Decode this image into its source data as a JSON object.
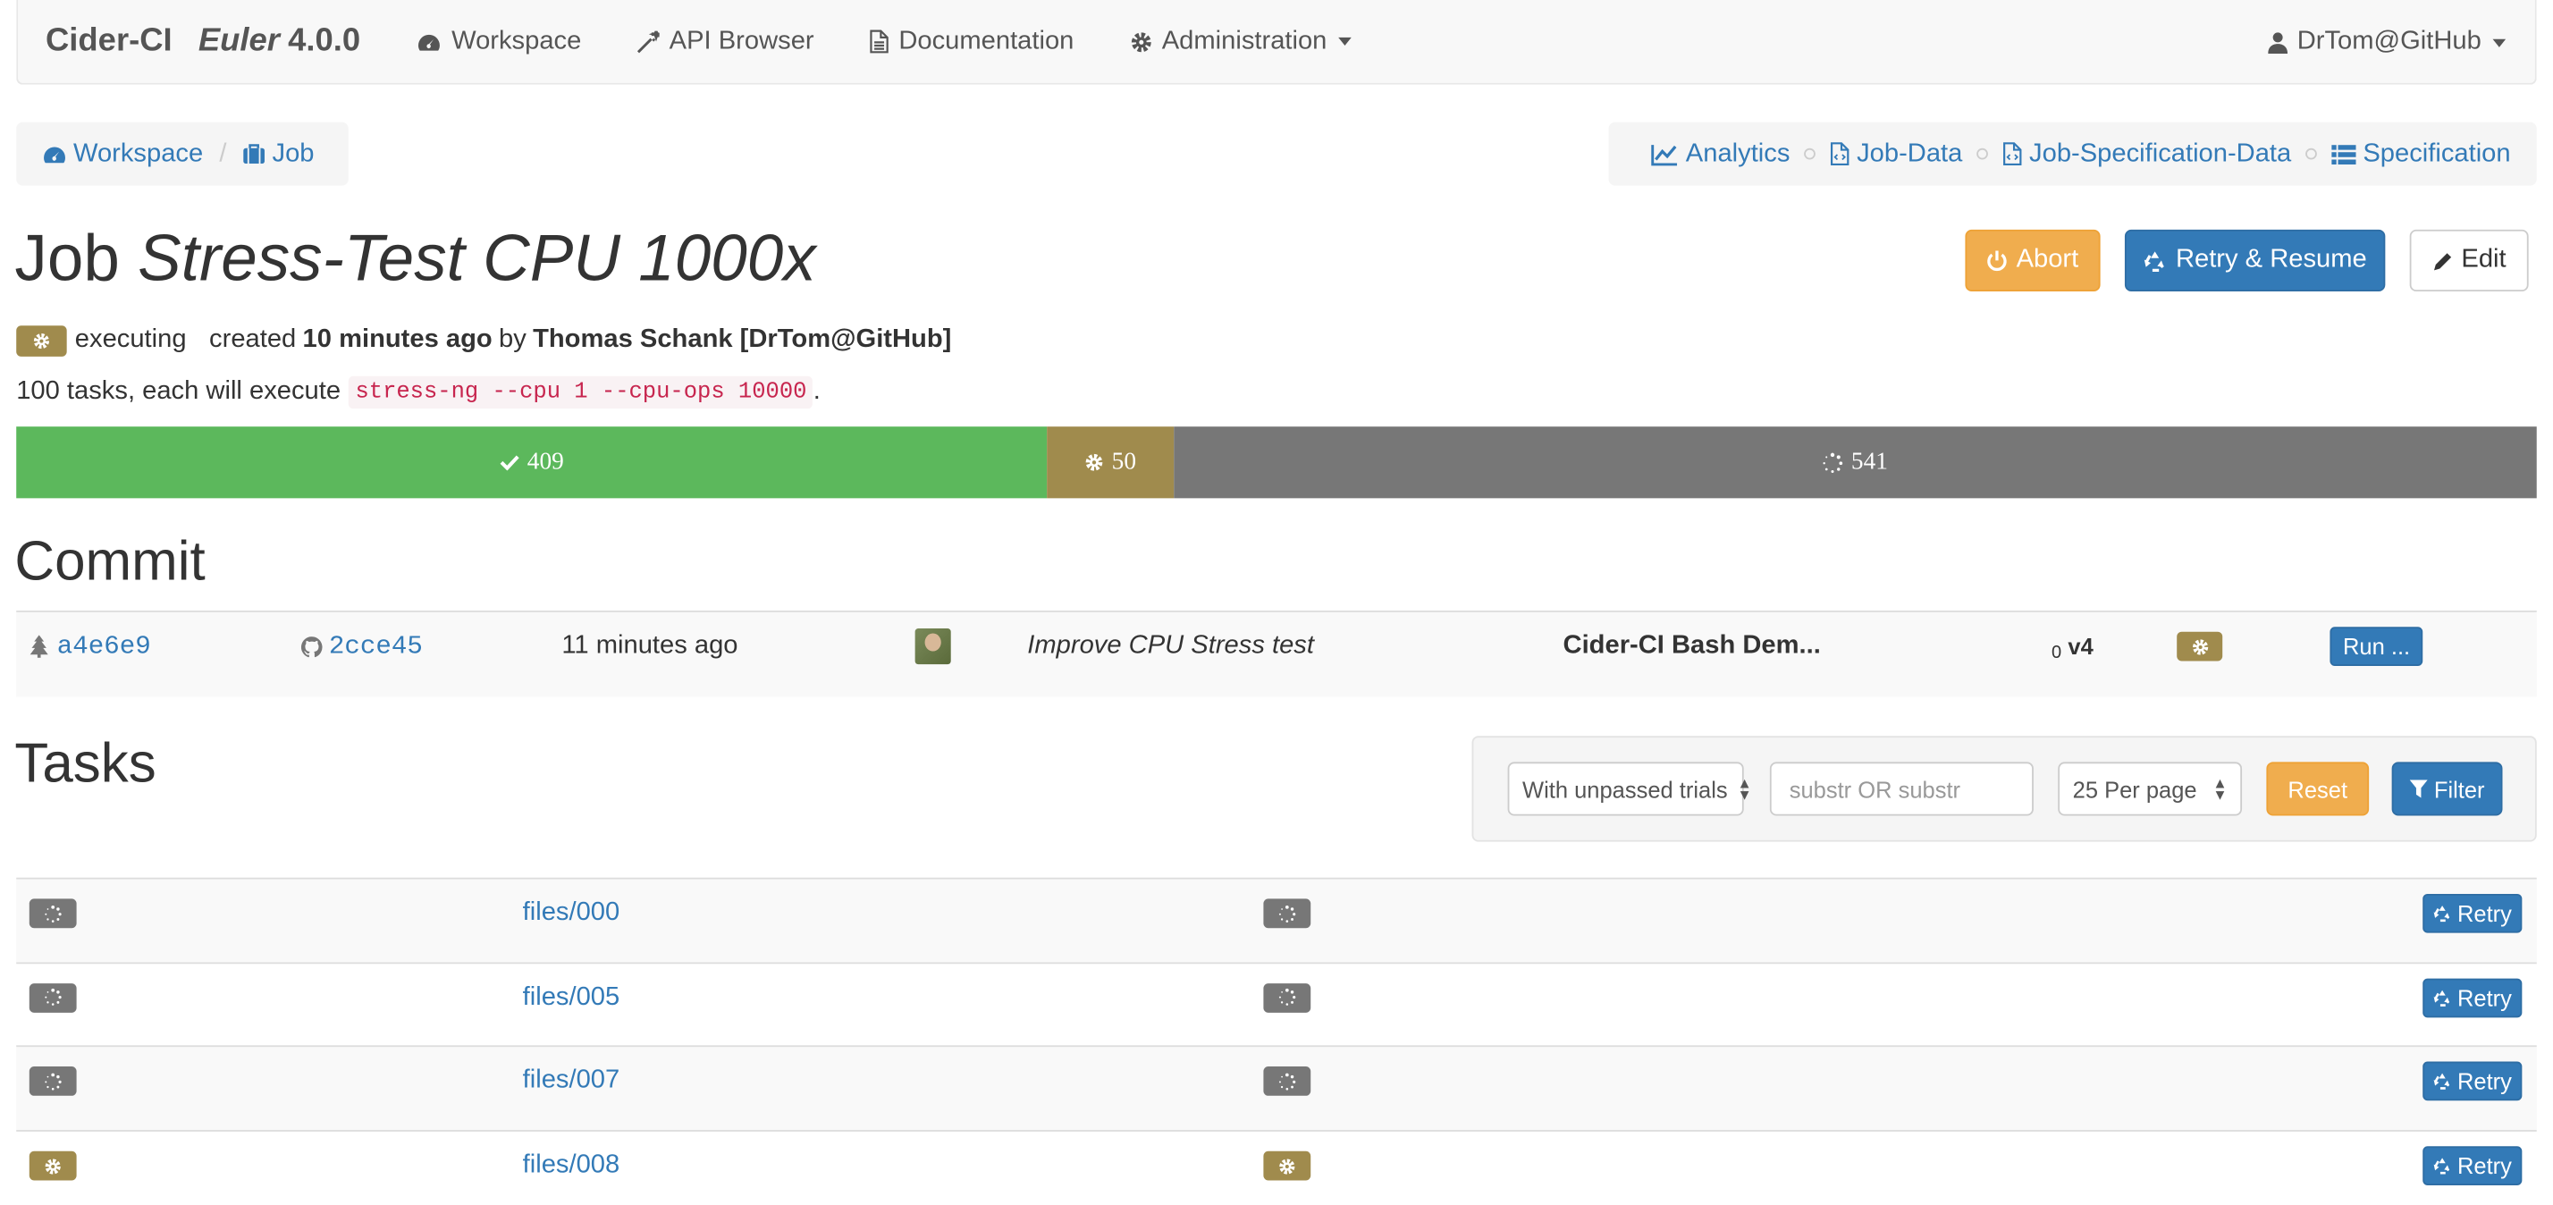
{
  "colors": {
    "primary": "#337ab7",
    "warning": "#f0ad4e",
    "success": "#5cb85c",
    "executing": "#a08b4d",
    "pending": "#777777",
    "code": "#c7254e"
  },
  "navbar": {
    "brand": "Cider-CI",
    "brand_name": "Euler",
    "version": "4.0.0",
    "items": [
      {
        "label": "Workspace",
        "icon": "dashboard-icon"
      },
      {
        "label": "API Browser",
        "icon": "magic-wand-icon"
      },
      {
        "label": "Documentation",
        "icon": "document-icon"
      },
      {
        "label": "Administration",
        "icon": "gear-icon"
      }
    ],
    "user": "DrTom@GitHub"
  },
  "breadcrumb": {
    "items": [
      {
        "label": "Workspace",
        "icon": "dashboard-icon"
      },
      {
        "label": "Job",
        "icon": "briefcase-icon"
      }
    ]
  },
  "links": [
    {
      "label": "Analytics",
      "icon": "line-chart-icon"
    },
    {
      "label": "Job-Data",
      "icon": "code-file-icon"
    },
    {
      "label": "Job-Specification-Data",
      "icon": "code-file-icon"
    },
    {
      "label": "Specification",
      "icon": "list-icon"
    }
  ],
  "job": {
    "title_prefix": "Job",
    "name": "Stress-Test CPU 1000x",
    "state": "executing",
    "created_prefix": "created",
    "created_ago": "10 minutes ago",
    "by": "by",
    "author": "Thomas Schank [DrTom@GitHub]",
    "desc_prefix": "100 tasks, each will execute",
    "command": "stress-ng --cpu 1 --cpu-ops 10000",
    "desc_suffix": "."
  },
  "actions": {
    "abort": "Abort",
    "retry_resume": "Retry & Resume",
    "edit": "Edit"
  },
  "progress": {
    "passed": 409,
    "executing": 50,
    "pending": 541
  },
  "commit": {
    "heading": "Commit",
    "tree_id": "a4e6e9",
    "commit_id": "2cce45",
    "time_ago": "11 minutes ago",
    "message": "Improve CPU Stress test",
    "repository": "Cider-CI Bash Dem...",
    "branch_count": "0",
    "branch": "v4",
    "run_label": "Run ..."
  },
  "tasks": {
    "heading": "Tasks",
    "filter": {
      "state_select": "With unpassed trials",
      "search_placeholder": "substr OR substr",
      "per_page": "25 Per page",
      "reset": "Reset",
      "filter": "Filter"
    },
    "retry_label": "Retry",
    "rows": [
      {
        "name": "files/000",
        "state": "pending",
        "trial_state": "pending"
      },
      {
        "name": "files/005",
        "state": "pending",
        "trial_state": "pending"
      },
      {
        "name": "files/007",
        "state": "pending",
        "trial_state": "pending"
      },
      {
        "name": "files/008",
        "state": "executing",
        "trial_state": "executing"
      }
    ]
  }
}
